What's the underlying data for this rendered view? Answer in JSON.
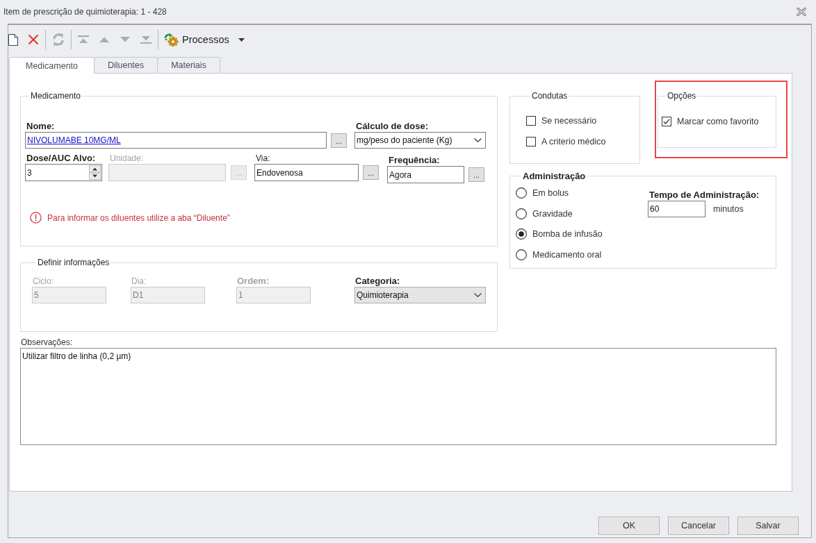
{
  "window": {
    "title": "Item de prescrição de quimioterapia: 1 - 428"
  },
  "toolbar": [
    {
      "kind": "new",
      "disabled": false
    },
    {
      "kind": "delete",
      "disabled": false
    },
    {
      "kind": "separator"
    },
    {
      "kind": "refresh",
      "disabled": true
    },
    {
      "kind": "separator"
    },
    {
      "kind": "first",
      "disabled": true
    },
    {
      "kind": "up",
      "disabled": true
    },
    {
      "kind": "down",
      "disabled": true
    },
    {
      "kind": "last",
      "disabled": true
    },
    {
      "kind": "separator"
    },
    {
      "kind": "menu",
      "label": "Processos",
      "disabled": false
    }
  ],
  "tabs": [
    {
      "label": "Medicamento",
      "selected": true
    },
    {
      "label": "Diluentes",
      "selected": false
    },
    {
      "label": "Materiais",
      "selected": false
    }
  ],
  "medication_group": {
    "title": "Medicamento",
    "name": {
      "label": "Nome:",
      "value": "NIVOLUMABE 10MG/ML",
      "button": "...",
      "required": true,
      "disabled": false
    },
    "dose_calculation": {
      "label": "Cálculo de dose:",
      "value": "mg/peso do paciente (Kg)",
      "required": true,
      "disabled": false
    },
    "target_dose": {
      "label": "Dose/AUC Alvo:",
      "value": "3",
      "required": true,
      "disabled": false
    },
    "unit": {
      "label": "Unidade:",
      "button": "...",
      "required": false,
      "disabled": true
    },
    "route": {
      "label": "Via:",
      "value": "Endovenosa",
      "button": "...",
      "required": false,
      "disabled": false
    },
    "frequency": {
      "label": "Frequência:",
      "value": "Agora",
      "button": "...",
      "required": true,
      "disabled": false
    },
    "notice": "Para informar os diluentes utilize a aba “Diluente”"
  },
  "info_group": {
    "title": "Definir informações",
    "cycle": {
      "label": "Ciclo:",
      "value": "5",
      "required": false,
      "disabled": true
    },
    "day": {
      "label": "Dia:",
      "value": "D1",
      "required": false,
      "disabled": true
    },
    "order": {
      "label": "Ordem:",
      "value": "1",
      "required": true,
      "disabled": true
    },
    "category": {
      "label": "Categoria:",
      "value": "Quimioterapia",
      "required": true,
      "disabled": false
    }
  },
  "conduct_group": {
    "title": "Condutas",
    "options": [
      {
        "label": "Se necessário",
        "checked": false
      },
      {
        "label": "A criterio médico",
        "checked": false
      }
    ]
  },
  "options_group": {
    "title": "Opções",
    "highlighted": true,
    "options": [
      {
        "label": "Marcar como favorito",
        "checked": true
      }
    ]
  },
  "administration_group": {
    "title": "Administração",
    "methods": [
      {
        "label": "Em bolus",
        "selected": false
      },
      {
        "label": "Gravidade",
        "selected": false
      },
      {
        "label": "Bomba de infusão",
        "selected": true
      },
      {
        "label": "Medicamento oral",
        "selected": false
      }
    ],
    "duration": {
      "label": "Tempo de Administração:",
      "value": "60",
      "unit": "minutos",
      "required": true,
      "disabled": false
    }
  },
  "notes": {
    "label": "Observações:",
    "value": "Utilizar filtro de linha (0,2 µm)"
  },
  "buttons": [
    "OK",
    "Cancelar",
    "Salvar"
  ]
}
